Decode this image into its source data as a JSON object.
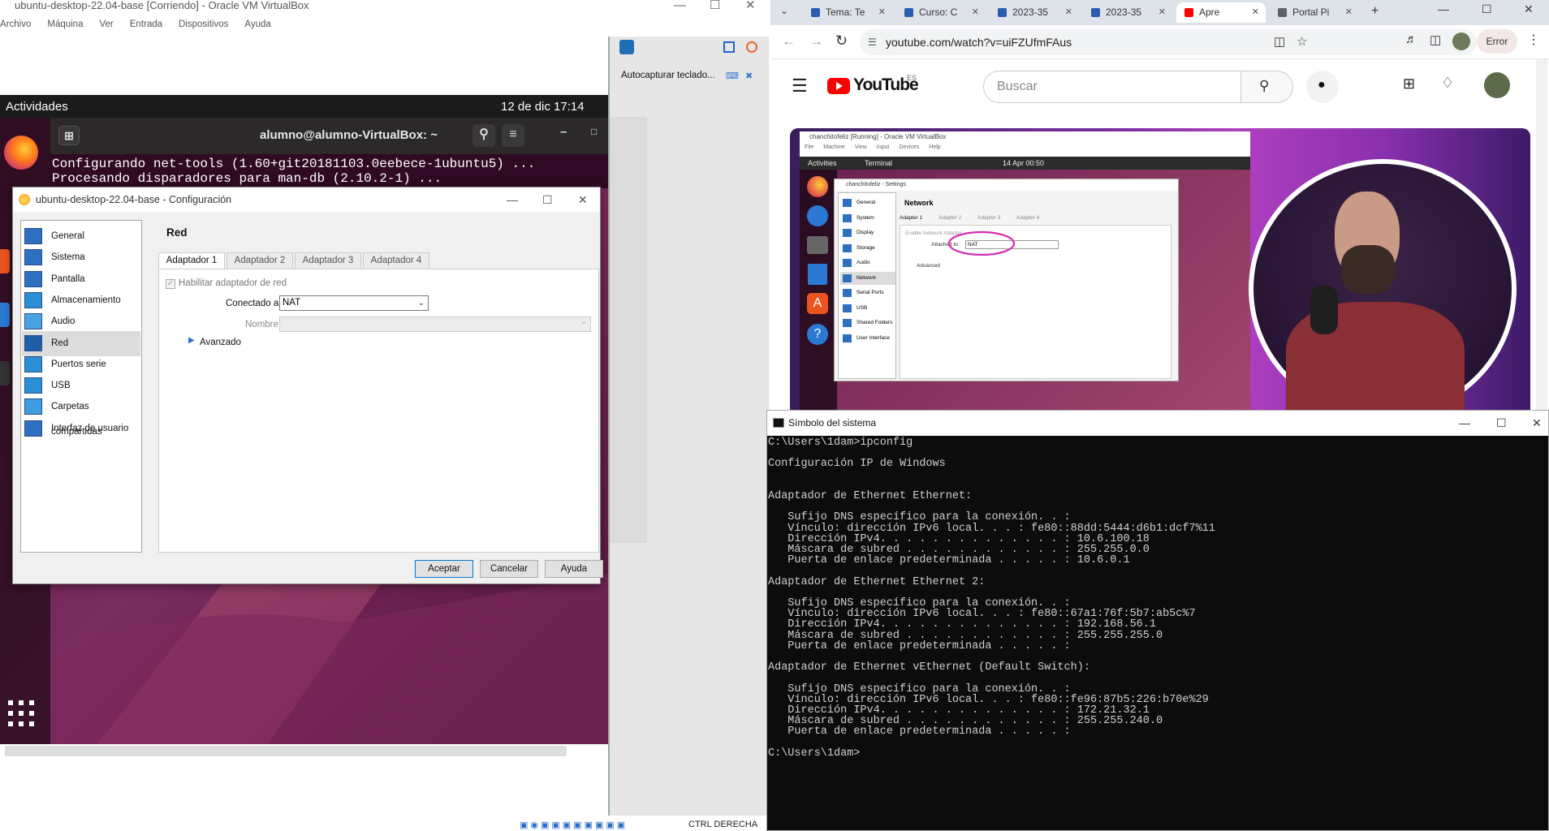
{
  "vbox": {
    "title": "ubuntu-desktop-22.04-base [Corriendo] - Oracle VM VirtualBox",
    "menu": [
      "Archivo",
      "Máquina",
      "Ver",
      "Entrada",
      "Dispositivos",
      "Ayuda"
    ],
    "status_right": "CTRL DERECHA",
    "side_panel": {
      "text": "Autocapturar teclado..."
    }
  },
  "ubuntu": {
    "activities": "Actividades",
    "clock": "12 de dic  17:14",
    "terminal_title": "alumno@alumno-VirtualBox: ~",
    "terminal_lines": [
      "Configurando net-tools (1.60+git20181103.0eebece-1ubuntu5) ...",
      "Procesando disparadores para man-db (2.10.2-1) ..."
    ]
  },
  "settings": {
    "title": "ubuntu-desktop-22.04-base - Configuración",
    "nav": [
      {
        "label": "General",
        "icon": "general-icon",
        "color": "#2f6fc0"
      },
      {
        "label": "Sistema",
        "icon": "system-icon",
        "color": "#2f6fc0"
      },
      {
        "label": "Pantalla",
        "icon": "display-icon",
        "color": "#2f6fc0"
      },
      {
        "label": "Almacenamiento",
        "icon": "storage-icon",
        "color": "#2a8fd6"
      },
      {
        "label": "Audio",
        "icon": "audio-icon",
        "color": "#4aa3e0"
      },
      {
        "label": "Red",
        "icon": "network-icon",
        "color": "#1e5fa8"
      },
      {
        "label": "Puertos serie",
        "icon": "serial-ports-icon",
        "color": "#2a8fd6"
      },
      {
        "label": "USB",
        "icon": "usb-icon",
        "color": "#2a8fd6"
      },
      {
        "label": "Carpetas compartidas",
        "icon": "shared-folders-icon",
        "color": "#3d9de0"
      },
      {
        "label": "Interfaz de usuario",
        "icon": "user-interface-icon",
        "color": "#2f6fc0"
      }
    ],
    "selected_nav": "Red",
    "section_title": "Red",
    "tabs": [
      "Adaptador 1",
      "Adaptador 2",
      "Adaptador 3",
      "Adaptador 4"
    ],
    "enable_label": "Habilitar adaptador de red",
    "attached_label": "Conectado a:",
    "attached_value": "NAT",
    "name_label": "Nombre:",
    "advanced_label": "Avanzado",
    "buttons": {
      "ok": "Aceptar",
      "cancel": "Cancelar",
      "help": "Ayuda"
    }
  },
  "chrome": {
    "tabs": [
      {
        "label": "Tema: Te"
      },
      {
        "label": "Curso: C"
      },
      {
        "label": "2023-35"
      },
      {
        "label": "2023-35"
      },
      {
        "label": "Apre"
      },
      {
        "label": "Portal Pi"
      }
    ],
    "url": "youtube.com/watch?v=uiFZUfmFAus",
    "profile_label": "Error"
  },
  "youtube": {
    "logo_text": "YouTube",
    "region": "ES",
    "search_placeholder": "Buscar"
  },
  "video": {
    "vm_title": "chanchitofeliz [Running] - Oracle VM VirtualBox",
    "vm_menu": [
      "File",
      "Machine",
      "View",
      "Input",
      "Devices",
      "Help"
    ],
    "activities": "Activities",
    "terminal": "Terminal",
    "clock": "14 Apr  00:50",
    "settings_title": "chanchitofeliz - Settings",
    "nav": [
      "General",
      "System",
      "Display",
      "Storage",
      "Audio",
      "Network",
      "Serial Ports",
      "USB",
      "Shared Folders",
      "User Interface"
    ],
    "section": "Network",
    "tabs": [
      "Adapter 1",
      "Adapter 2",
      "Adapter 3",
      "Adapter 4"
    ],
    "enable_label": "Enable Network Adapter",
    "attached_label": "Attached to:",
    "attached_value": "NAT",
    "advanced": "Advanced"
  },
  "cmd": {
    "title": "Símbolo del sistema",
    "lines": [
      "C:\\Users\\1dam>ipconfig",
      "",
      "Configuración IP de Windows",
      "",
      "",
      "Adaptador de Ethernet Ethernet:",
      "",
      "   Sufijo DNS específico para la conexión. . :",
      "   Vínculo: dirección IPv6 local. . . : fe80::88dd:5444:d6b1:dcf7%11",
      "   Dirección IPv4. . . . . . . . . . . . . . : 10.6.100.18",
      "   Máscara de subred . . . . . . . . . . . . : 255.255.0.0",
      "   Puerta de enlace predeterminada . . . . . : 10.6.0.1",
      "",
      "Adaptador de Ethernet Ethernet 2:",
      "",
      "   Sufijo DNS específico para la conexión. . :",
      "   Vínculo: dirección IPv6 local. . . : fe80::67a1:76f:5b7:ab5c%7",
      "   Dirección IPv4. . . . . . . . . . . . . . : 192.168.56.1",
      "   Máscara de subred . . . . . . . . . . . . : 255.255.255.0",
      "   Puerta de enlace predeterminada . . . . . :",
      "",
      "Adaptador de Ethernet vEthernet (Default Switch):",
      "",
      "   Sufijo DNS específico para la conexión. . :",
      "   Vínculo: dirección IPv6 local. . . : fe80::fe96:87b5:226:b70e%29",
      "   Dirección IPv4. . . . . . . . . . . . . . : 172.21.32.1",
      "   Máscara de subred . . . . . . . . . . . . : 255.255.240.0",
      "   Puerta de enlace predeterminada . . . . . :",
      "",
      "C:\\Users\\1dam>"
    ]
  }
}
